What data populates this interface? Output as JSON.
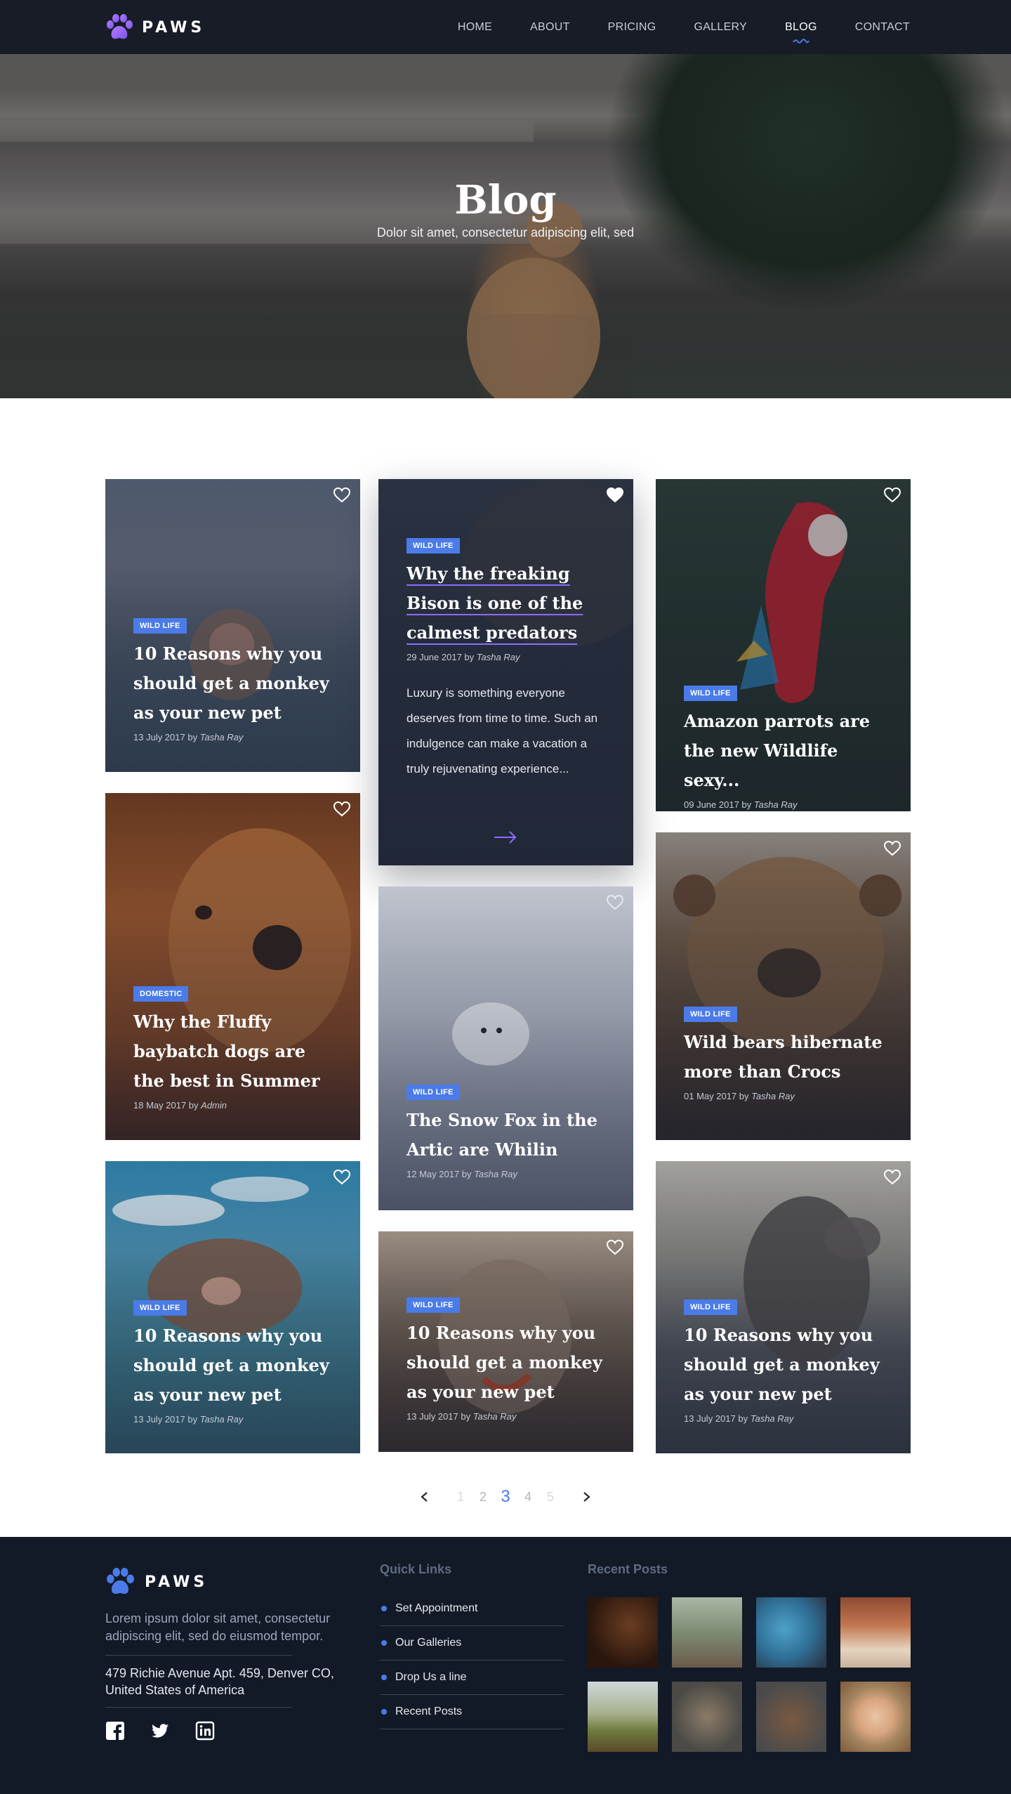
{
  "header": {
    "logo_text": "PAWS",
    "nav": [
      {
        "label": "HOME",
        "active": false
      },
      {
        "label": "ABOUT",
        "active": false
      },
      {
        "label": "PRICING",
        "active": false
      },
      {
        "label": "GALLERY",
        "active": false
      },
      {
        "label": "BLOG",
        "active": true
      },
      {
        "label": "CONTACT",
        "active": false
      }
    ]
  },
  "hero": {
    "title": "Blog",
    "subtitle": "Dolor sit amet, consectetur adipiscing elit, sed"
  },
  "cards": [
    {
      "tag": "WILD LIFE",
      "title": "10 Reasons why you should get a monkey as your new pet",
      "date": "13 July 2017",
      "by": "by",
      "author": "Tasha Ray",
      "liked": false
    },
    {
      "tag": "WILD LIFE",
      "title": "Why the freaking Bison is one of the calmest predators",
      "date": "29 June 2017",
      "by": "by",
      "author": "Tasha Ray",
      "liked": true,
      "excerpt": "Luxury is something everyone deserves from time to time. Such an indulgence can make a vacation a truly rejuvenating experience..."
    },
    {
      "tag": "WILD LIFE",
      "title": "Amazon parrots are the new Wildlife sexy...",
      "date": "09 June 2017",
      "by": "by",
      "author": "Tasha Ray",
      "liked": false
    },
    {
      "tag": "DOMESTIC",
      "title": "Why the Fluffy baybatch dogs are the best in Summer",
      "date": "18 May 2017",
      "by": "by",
      "author": "Admin",
      "liked": false
    },
    {
      "tag": "WILD LIFE",
      "title": "The Snow Fox in the Artic are Whilin",
      "date": "12 May 2017",
      "by": "by",
      "author": "Tasha Ray",
      "liked": false
    },
    {
      "tag": "WILD LIFE",
      "title": "Wild bears hibernate more than Crocs",
      "date": "01 May 2017",
      "by": "by",
      "author": "Tasha Ray",
      "liked": false
    },
    {
      "tag": "WILD LIFE",
      "title": "10 Reasons why you should get a monkey as your new pet",
      "date": "13 July 2017",
      "by": "by",
      "author": "Tasha Ray",
      "liked": false
    },
    {
      "tag": "WILD LIFE",
      "title": "10 Reasons why you should get a monkey as your new pet",
      "date": "13 July 2017",
      "by": "by",
      "author": "Tasha Ray",
      "liked": false
    },
    {
      "tag": "WILD LIFE",
      "title": "10 Reasons why you should get a monkey as your new pet",
      "date": "13 July 2017",
      "by": "by",
      "author": "Tasha Ray",
      "liked": false
    }
  ],
  "pagination": {
    "pages": [
      "1",
      "2",
      "3",
      "4",
      "5"
    ],
    "current": "3"
  },
  "footer": {
    "logo_text": "PAWS",
    "about": "Lorem ipsum dolor sit amet, consectetur adipiscing elit, sed do eiusmod tempor.",
    "address": "479 Richie Avenue Apt. 459, Denver CO, United States of America",
    "socials": [
      "facebook-icon",
      "twitter-icon",
      "linkedin-icon"
    ],
    "quick_links_heading": "Quick Links",
    "quick_links": [
      "Set Appointment",
      "Our Galleries",
      "Drop Us a line",
      "Recent Posts"
    ],
    "recent_posts_heading": "Recent Posts"
  },
  "colors": {
    "accent": "#4a7be8",
    "purple": "#8c6cff",
    "header_bg": "#181c27",
    "footer_bg": "#131a27"
  }
}
